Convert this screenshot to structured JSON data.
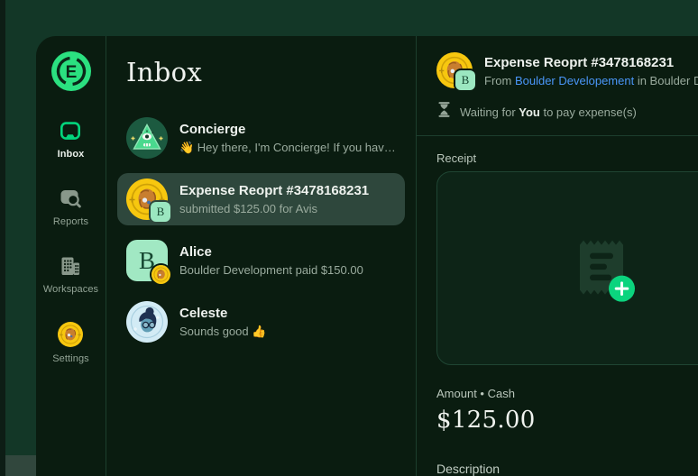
{
  "app_name": "Expensify",
  "sidebar": {
    "items": [
      {
        "label": "Inbox",
        "icon": "inbox-icon",
        "active": true
      },
      {
        "label": "Reports",
        "icon": "reports-icon",
        "active": false
      },
      {
        "label": "Workspaces",
        "icon": "workspaces-icon",
        "active": false
      },
      {
        "label": "Settings",
        "icon": "settings-avatar",
        "active": false
      }
    ]
  },
  "inbox": {
    "title": "Inbox",
    "items": [
      {
        "name": "Concierge",
        "preview": "👋 Hey there, I'm Concierge! If you hav…",
        "avatar": "concierge-avatar",
        "selected": false
      },
      {
        "name": "Expense Reoprt #3478168231",
        "preview": "submitted $125.00 for Avis",
        "avatar": "coin-avatar-with-b-badge",
        "selected": true
      },
      {
        "name": "Alice",
        "preview": "Boulder Development paid $150.00",
        "avatar": "boulder-b-avatar-with-coin-badge",
        "selected": false
      },
      {
        "name": "Celeste",
        "preview": "Sounds good 👍",
        "avatar": "celeste-avatar",
        "selected": false
      }
    ]
  },
  "detail": {
    "title": "Expense Reoprt #3478168231",
    "from_prefix": "From ",
    "workspace_link": "Boulder Developement",
    "in_word": " in ",
    "workspace_suffix": "Boulder Developement",
    "status_prefix": "Waiting for ",
    "status_actor": "You",
    "status_suffix": " to pay expense(s)",
    "receipt_label": "Receipt",
    "amount_label": "Amount • Cash",
    "amount_value": "$125.00",
    "description_label": "Description"
  },
  "colors": {
    "accent_green": "#03d47c",
    "logo_green": "#2be080",
    "link_blue": "#4a96f8",
    "coin_yellow": "#f7c70f",
    "mint": "#a1e8c3",
    "frame_green": "#133727",
    "app_background": "#0a1c10",
    "selected_row": "#2e473c"
  }
}
